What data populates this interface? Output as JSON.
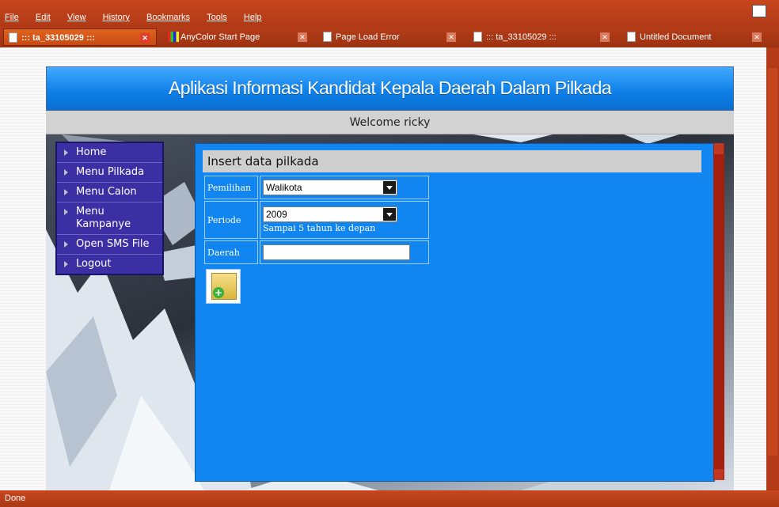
{
  "browser": {
    "menu": [
      "File",
      "Edit",
      "View",
      "History",
      "Bookmarks",
      "Tools",
      "Help"
    ],
    "tabs": [
      {
        "label": "::: ta_33105029 :::",
        "active": true
      },
      {
        "label": "AnyColor Start Page",
        "active": false
      },
      {
        "label": "Page Load Error",
        "active": false
      },
      {
        "label": "::: ta_33105029 :::",
        "active": false
      },
      {
        "label": "Untitled Document",
        "active": false
      }
    ],
    "status": "Done",
    "accent": "#c8461e"
  },
  "site": {
    "title": "Aplikasi Informasi Kandidat Kepala Daerah Dalam Pilkada",
    "welcome": "Welcome ricky",
    "nav": [
      "Home",
      "Menu Pilkada",
      "Menu Calon",
      "Menu Kampanye",
      "Open SMS File",
      "Logout"
    ]
  },
  "form": {
    "title": "Insert data pilkada",
    "fields": {
      "pemilihan": {
        "label": "Pemilihan",
        "value": "Walikota"
      },
      "periode": {
        "label": "Periode",
        "value": "2009",
        "hint": "Sampai 5 tahun ke depan"
      },
      "daerah": {
        "label": "Daerah",
        "value": ""
      }
    },
    "panel_color": "#1185f0"
  }
}
